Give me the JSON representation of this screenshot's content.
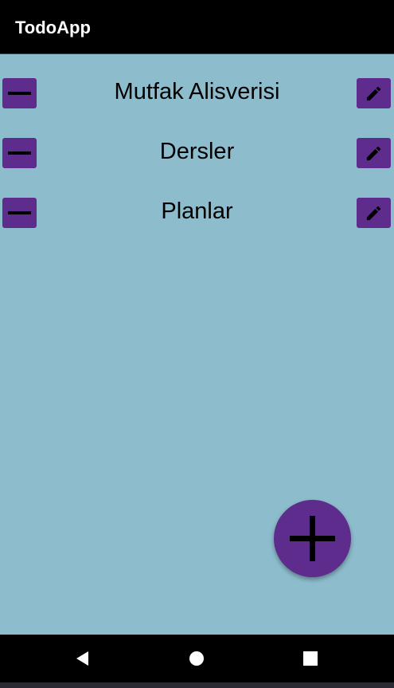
{
  "app": {
    "title": "TodoApp"
  },
  "todos": [
    {
      "label": "Mutfak Alisverisi"
    },
    {
      "label": "Dersler"
    },
    {
      "label": "Planlar"
    }
  ],
  "icons": {
    "delete": "minus-icon",
    "edit": "pencil-icon",
    "add": "plus-icon",
    "nav_back": "triangle-back-icon",
    "nav_home": "circle-home-icon",
    "nav_recents": "square-recents-icon"
  },
  "colors": {
    "app_bar": "#000000",
    "content_background": "#8dbdcd",
    "accent": "#5e2c8d",
    "icon": "#000000",
    "title_text": "#ffffff"
  }
}
